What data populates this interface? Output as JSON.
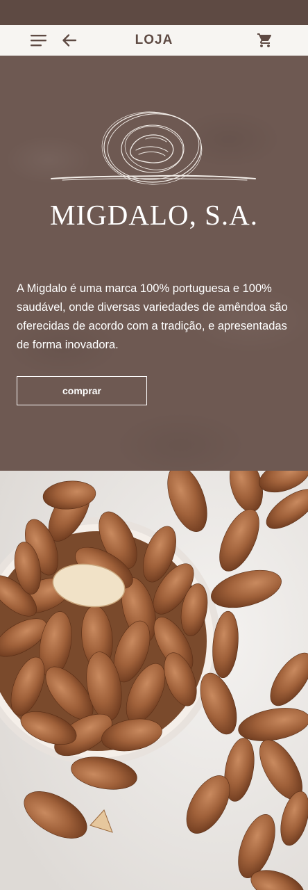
{
  "header": {
    "title": "LOJA",
    "menu_icon": "hamburger-menu-icon",
    "back_icon": "arrow-left-icon",
    "cart_icon": "shopping-cart-icon"
  },
  "hero": {
    "brand": "MIGDALO, S.A.",
    "description": "A Migdalo é uma marca 100% portuguesa e 100% saudável, onde diversas variedades de amêndoa são oferecidas de acordo com a tradição, e apresentadas de forma inovadora.",
    "button_label": "comprar"
  },
  "colors": {
    "hero_background": "#6e5952",
    "navbar_background": "#f7f5f2",
    "title_color": "#5e4a43",
    "almond": "#a0613a"
  }
}
